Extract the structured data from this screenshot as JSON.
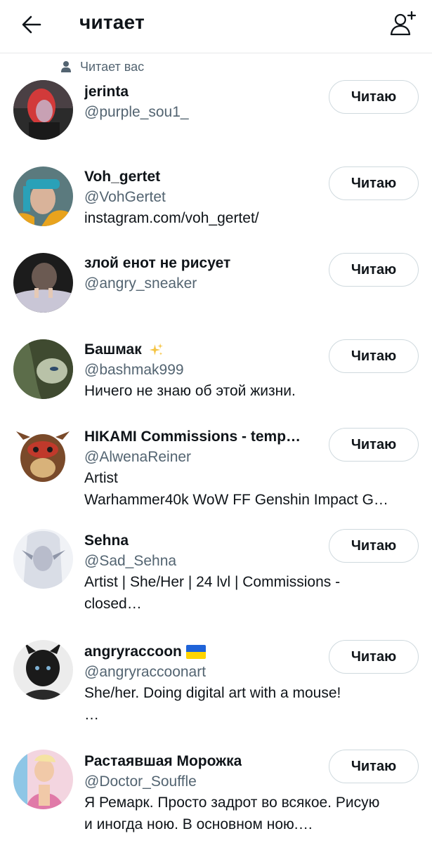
{
  "header": {
    "title": "читает"
  },
  "follows_you_label": "Читает вас",
  "follow_button_label": "Читаю",
  "users": [
    {
      "name": "jerinta",
      "handle": "@purple_sou1_",
      "bio": [],
      "badge": "",
      "avatar_colors": [
        "#2b2b2b",
        "#d23a3a",
        "#c8a1b4"
      ]
    },
    {
      "name": "Voh_gertet",
      "handle": "@VohGertet",
      "bio": [
        "instagram.com/voh_gertet/"
      ],
      "badge": "",
      "avatar_colors": [
        "#5b7a7e",
        "#2aa1b8",
        "#e8a31d"
      ]
    },
    {
      "name": "злой енот не рисует",
      "handle": "@angry_sneaker",
      "bio": [],
      "badge": "",
      "avatar_colors": [
        "#1c1c1c",
        "#6b5a52",
        "#c9c6d6"
      ]
    },
    {
      "name": "Башмак",
      "handle": "@bashmak999",
      "bio": [
        "Ничего не знаю об этой жизни."
      ],
      "badge": "sparkles",
      "avatar_colors": [
        "#5c6d4a",
        "#b9c2a8",
        "#3f4a30"
      ]
    },
    {
      "name": "HIKAMI Commissions - temp…",
      "handle": "@AlwenaReiner",
      "bio": [
        "Artist",
        "Warhammer40k WoW FF Genshin Impact G…"
      ],
      "badge": "",
      "avatar_colors": [
        "#ffffff",
        "#7a4a2a",
        "#c0392b"
      ]
    },
    {
      "name": "Sehna",
      "handle": "@Sad_Sehna",
      "bio": [
        "Artist | She/Her | 24 lvl | Commissions -",
        "closed…"
      ],
      "badge": "",
      "avatar_colors": [
        "#d9dde6",
        "#8f96a8",
        "#f0f2f6"
      ]
    },
    {
      "name": "angryraccoon",
      "handle": "@angryraccoonart",
      "bio": [
        "She/her. Doing digital art with a mouse!",
        "…"
      ],
      "badge": "ua-flag",
      "avatar_colors": [
        "#ececec",
        "#1a1a1a",
        "#7fb3d5"
      ]
    },
    {
      "name": "Растаявшая Морожка",
      "handle": "@Doctor_Souffle",
      "bio": [
        "Я Ремарк. Просто задрот во всякое. Рисую",
        "и иногда ною. В основном ною.…"
      ],
      "badge": "",
      "avatar_colors": [
        "#f3d5e0",
        "#e07aa8",
        "#8ec6e6"
      ]
    }
  ],
  "colors": {
    "text_primary": "#0f1419",
    "text_secondary": "#536471",
    "divider": "#e7e9ea",
    "button_border": "#cfd9de",
    "sparkle": "#f5c443",
    "flag_blue": "#1f63d8",
    "flag_yellow": "#ffd400"
  },
  "icons": {
    "back": "arrow-left-icon",
    "add_user": "add-user-icon",
    "follows_you": "person-icon"
  }
}
